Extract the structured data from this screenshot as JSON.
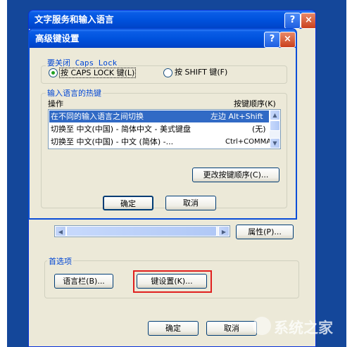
{
  "outer_dialog": {
    "title": "文字服务和输入语言",
    "help_label": "?",
    "close_label": "×",
    "properties_label": "属性(P)...",
    "preferences": {
      "group_label": "首选项",
      "language_bar_label": "语言栏(B)...",
      "key_settings_label": "键设置(K)..."
    },
    "ok_label": "确定",
    "cancel_label": "取消"
  },
  "inner_dialog": {
    "title": "高级键设置",
    "help_label": "?",
    "close_label": "×",
    "caps_group": {
      "label": "要关闭 Caps Lock",
      "option_caps": "按 CAPS LOCK 键(L)",
      "option_shift": "按 SHIFT 键(F)",
      "selected": "caps"
    },
    "hotkeys_group": {
      "label": "输入语言的热键",
      "col_action": "操作",
      "col_keys": "按键顺序(K)",
      "rows": [
        {
          "action": "在不同的输入语言之间切换",
          "keys": "左边 Alt+Shift"
        },
        {
          "action": "切换至 中文(中国) - 简体中文 - 美式键盘",
          "keys": "(无)"
        },
        {
          "action": "切换至 中文(中国) - 中文 (简体) -...",
          "keys": "Ctrl+COMMA"
        }
      ],
      "change_keys_label": "更改按键顺序(C)..."
    },
    "ok_label": "确定",
    "cancel_label": "取消"
  },
  "watermark": {
    "text": "系统之家"
  },
  "colors": {
    "desktop_blue": "#14479a",
    "highlight_red": "#e0201e",
    "selection_blue": "#316ac5",
    "group_label_blue": "#0046d5"
  }
}
